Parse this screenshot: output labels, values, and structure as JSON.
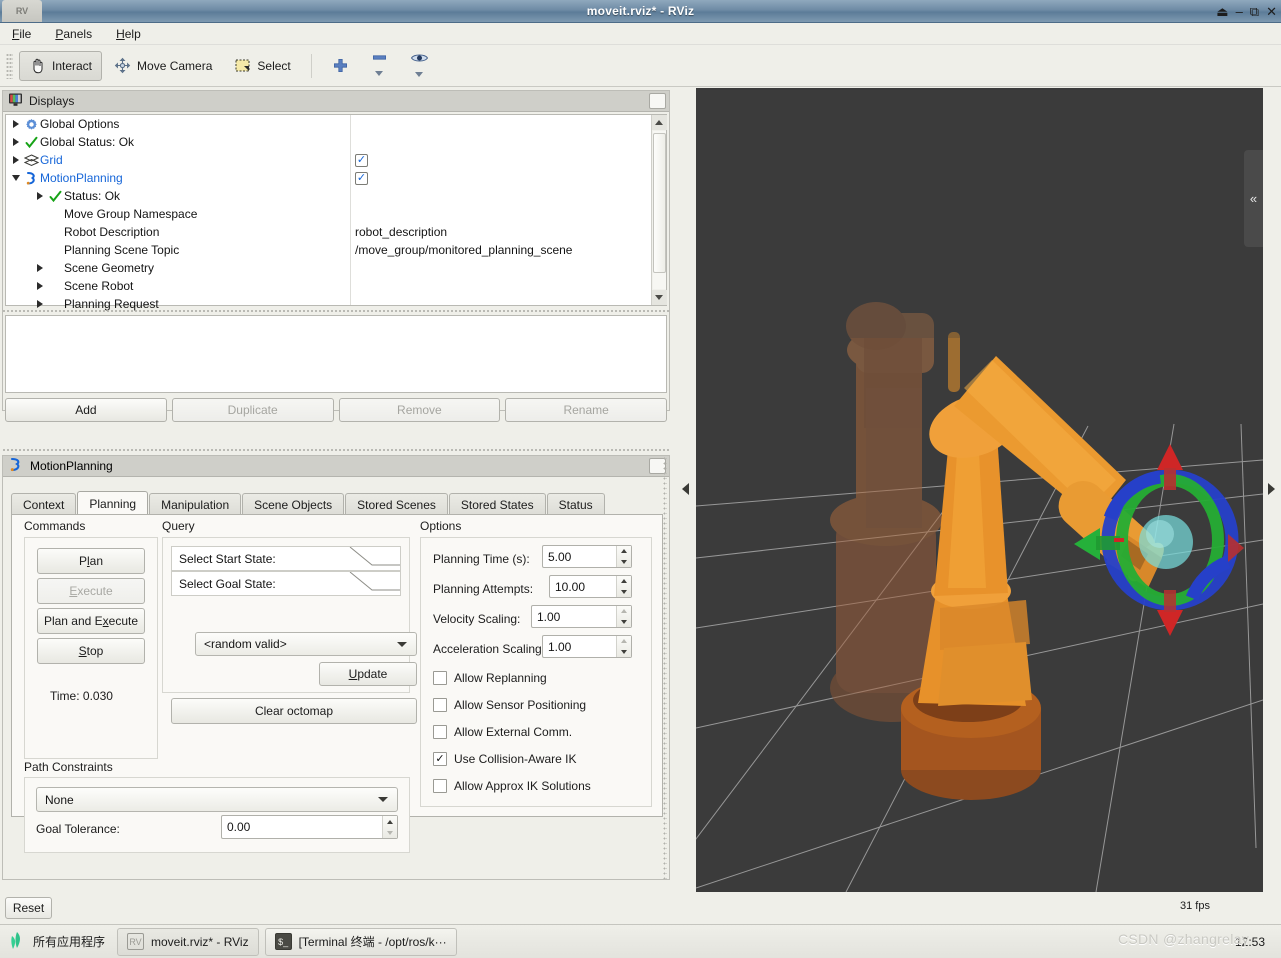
{
  "window": {
    "title": "moveit.rviz* - RViz",
    "app_icon": "rviz-icon",
    "controls": {
      "shade": "⏏",
      "minimize": "–",
      "maximize": "⧉",
      "close": "✕"
    }
  },
  "menubar": [
    {
      "label": "File",
      "accel": "F"
    },
    {
      "label": "Panels",
      "accel": "P"
    },
    {
      "label": "Help",
      "accel": "H"
    }
  ],
  "toolbar": {
    "interact": "Interact",
    "move_camera": "Move Camera",
    "select": "Select",
    "icons": [
      "hand-cursor-icon",
      "move-camera-icon",
      "select-rect-icon",
      "plus-icon",
      "minus-icon",
      "eye-focus-icon"
    ]
  },
  "displays_panel": {
    "title": "Displays",
    "tree": [
      {
        "label": "Global Options",
        "icon": "gear-icon",
        "expander": "right",
        "indent": 0,
        "value": "",
        "check": null,
        "link": false
      },
      {
        "label": "Global Status: Ok",
        "icon": "check-icon",
        "expander": "right",
        "indent": 0,
        "value": "",
        "check": null,
        "link": false
      },
      {
        "label": "Grid",
        "icon": "grid-icon",
        "expander": "right",
        "indent": 0,
        "value": "",
        "check": true,
        "link": true
      },
      {
        "label": "MotionPlanning",
        "icon": "moveit-icon",
        "expander": "down",
        "indent": 0,
        "value": "",
        "check": true,
        "link": true
      },
      {
        "label": "Status: Ok",
        "icon": "check-icon",
        "expander": "right",
        "indent": 1,
        "value": "",
        "check": null,
        "link": false
      },
      {
        "label": "Move Group Namespace",
        "icon": "",
        "expander": "none",
        "indent": 1,
        "value": "",
        "check": null,
        "link": false
      },
      {
        "label": "Robot Description",
        "icon": "",
        "expander": "none",
        "indent": 1,
        "value": "robot_description",
        "check": null,
        "link": false
      },
      {
        "label": "Planning Scene Topic",
        "icon": "",
        "expander": "none",
        "indent": 1,
        "value": "/move_group/monitored_planning_scene",
        "check": null,
        "link": false
      },
      {
        "label": "Scene Geometry",
        "icon": "",
        "expander": "right",
        "indent": 1,
        "value": "",
        "check": null,
        "link": false
      },
      {
        "label": "Scene Robot",
        "icon": "",
        "expander": "right",
        "indent": 1,
        "value": "",
        "check": null,
        "link": false
      },
      {
        "label": "Planning Request",
        "icon": "",
        "expander": "right",
        "indent": 1,
        "value": "",
        "check": null,
        "link": false
      }
    ],
    "buttons": [
      {
        "label": "Add",
        "enabled": true
      },
      {
        "label": "Duplicate",
        "enabled": false
      },
      {
        "label": "Remove",
        "enabled": false
      },
      {
        "label": "Rename",
        "enabled": false
      }
    ]
  },
  "motion_planning_panel": {
    "title": "MotionPlanning",
    "icon": "moveit-icon",
    "tabs": [
      {
        "label": "Context",
        "active": false
      },
      {
        "label": "Planning",
        "active": true
      },
      {
        "label": "Manipulation",
        "active": false
      },
      {
        "label": "Scene Objects",
        "active": false
      },
      {
        "label": "Stored Scenes",
        "active": false
      },
      {
        "label": "Stored States",
        "active": false
      },
      {
        "label": "Status",
        "active": false
      }
    ],
    "commands": {
      "title": "Commands",
      "plan": {
        "text": "P",
        "accel": "l",
        "rest": "an",
        "label": "Plan",
        "enabled": true
      },
      "execute": {
        "label": "Execute",
        "enabled": false
      },
      "plan_and_execute": {
        "label": "Plan and Execute",
        "enabled": true
      },
      "stop": {
        "label": "Stop",
        "enabled": true
      },
      "time_label": "Time: 0.030"
    },
    "query": {
      "title": "Query",
      "select_start_state": "Select Start State:",
      "select_goal_state": "Select Goal State:",
      "goal_state_value": "<random valid>",
      "update_button": "Update",
      "clear_octomap_button": "Clear octomap"
    },
    "options": {
      "title": "Options",
      "fields": [
        {
          "label": "Planning Time (s):",
          "value": "5.00",
          "enabled": true
        },
        {
          "label": "Planning Attempts:",
          "value": "10.00",
          "enabled": true
        },
        {
          "label": "Velocity Scaling:",
          "value": "1.00",
          "enabled": true
        },
        {
          "label": "Acceleration Scaling:",
          "value": "1.00",
          "enabled": true
        }
      ],
      "checkboxes": [
        {
          "label": "Allow Replanning",
          "checked": false
        },
        {
          "label": "Allow Sensor Positioning",
          "checked": false
        },
        {
          "label": "Allow External Comm.",
          "checked": false
        },
        {
          "label": "Use Collision-Aware IK",
          "checked": true
        },
        {
          "label": "Allow Approx IK Solutions",
          "checked": false
        }
      ]
    },
    "path_constraints": {
      "title": "Path Constraints",
      "constraint_value": "None",
      "goal_tolerance_label": "Goal Tolerance:",
      "goal_tolerance_value": "0.00"
    }
  },
  "viewport": {
    "fps": "31 fps",
    "collapse_icon": "«",
    "background_color": "#3b3b3b",
    "grid_color": "#b4b4b4",
    "robot_goal_color": "#e08a22",
    "robot_start_color": "#b06a3a",
    "marker_colors": {
      "x_axis": "#cc2222",
      "y_axis": "#22aa33",
      "z_axis": "#2233cc",
      "sphere": "#6fd8d8"
    }
  },
  "bottom": {
    "reset_button": "Reset",
    "taskbar": {
      "all_apps": "所有应用程序",
      "tasks": [
        {
          "label": "moveit.rviz* - RViz",
          "icon": "rviz-icon",
          "active": true
        },
        {
          "label": "[Terminal 终端 - /opt/ros/k···",
          "icon": "terminal-icon",
          "active": false
        }
      ],
      "clock": "12:53"
    },
    "watermark": "CSDN @zhangrelay"
  }
}
